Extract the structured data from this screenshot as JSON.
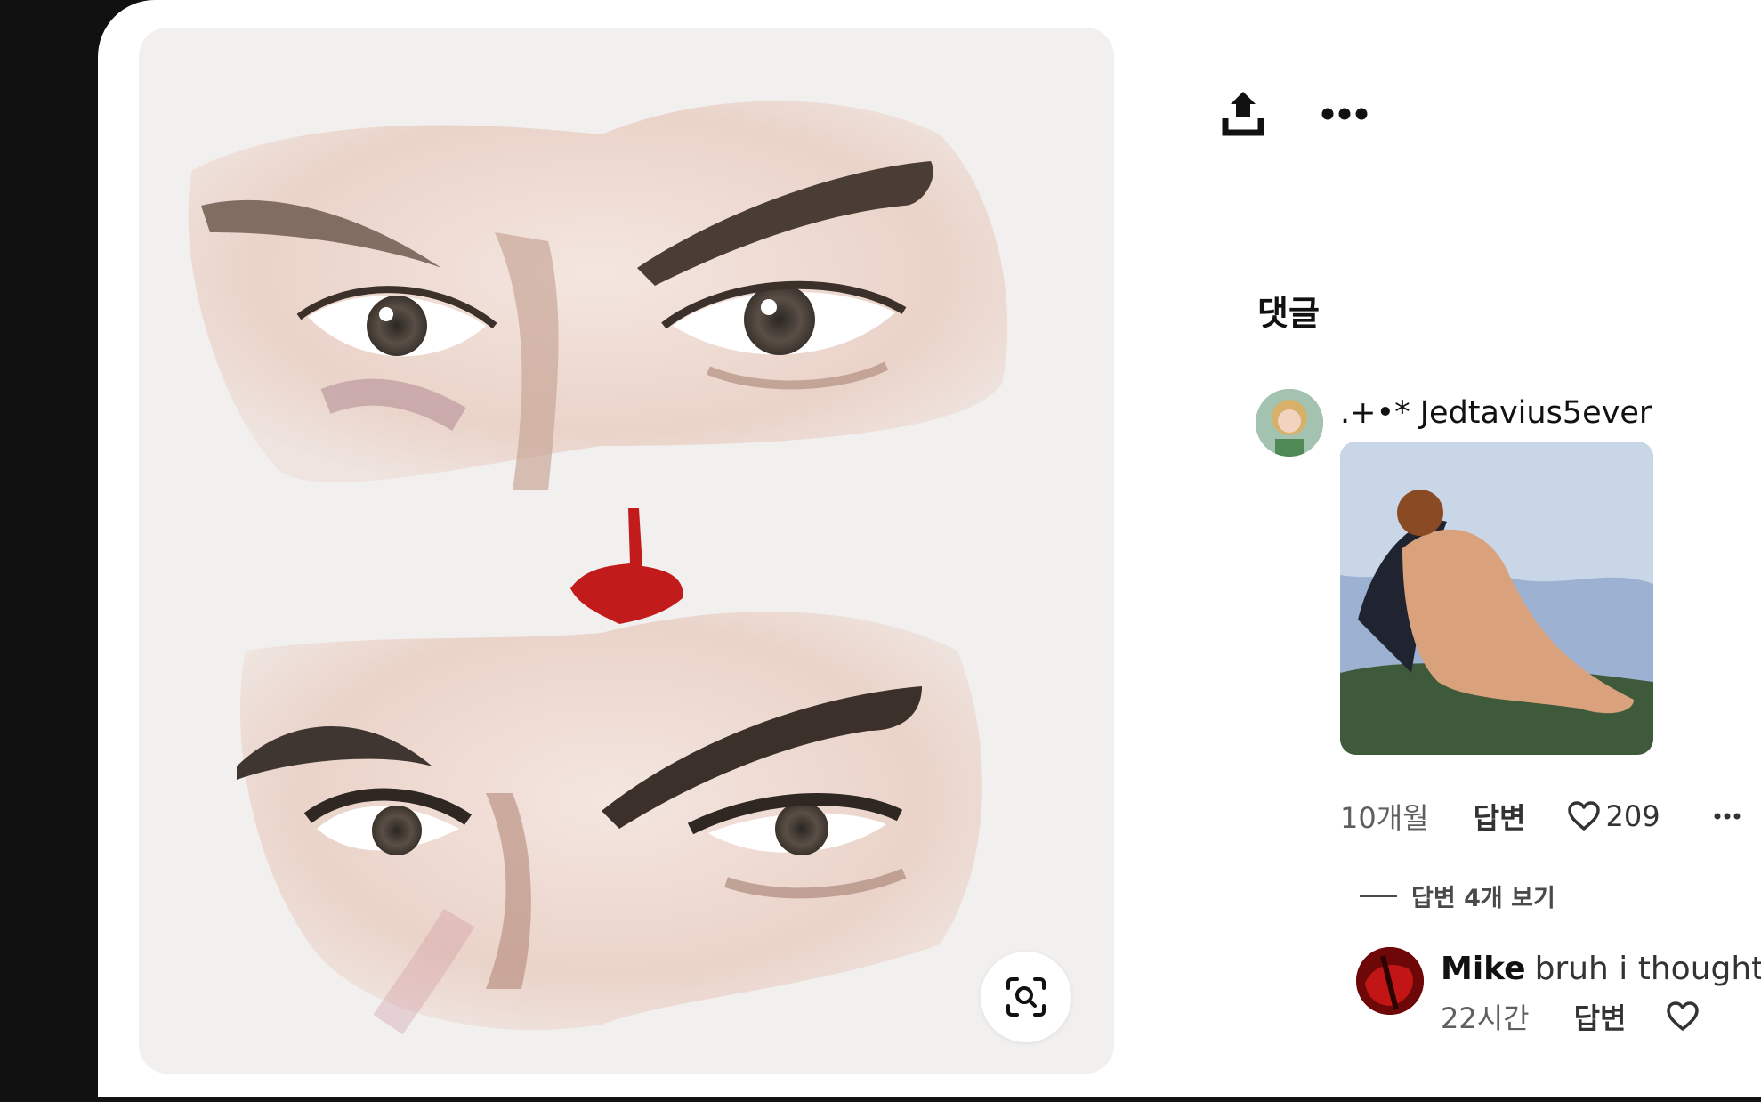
{
  "comments": {
    "heading": "댓글",
    "items": [
      {
        "username": ".+•* Jedtavius5ever",
        "time": "10개월",
        "reply_label": "답변",
        "likes": "209",
        "view_replies": "답변 4개 보기",
        "replies": [
          {
            "author": "Mike",
            "text": "bruh i thought o",
            "time": "22시간",
            "reply_label": "답변"
          }
        ]
      }
    ]
  },
  "icons": {
    "share": "share-icon",
    "more": "more-icon",
    "lens": "visual-search-icon",
    "like": "heart-icon"
  },
  "colors": {
    "background": "#111111",
    "card": "#ffffff",
    "arrow": "#c21b1b",
    "text": "#111111",
    "muted": "#5f5f5f"
  }
}
